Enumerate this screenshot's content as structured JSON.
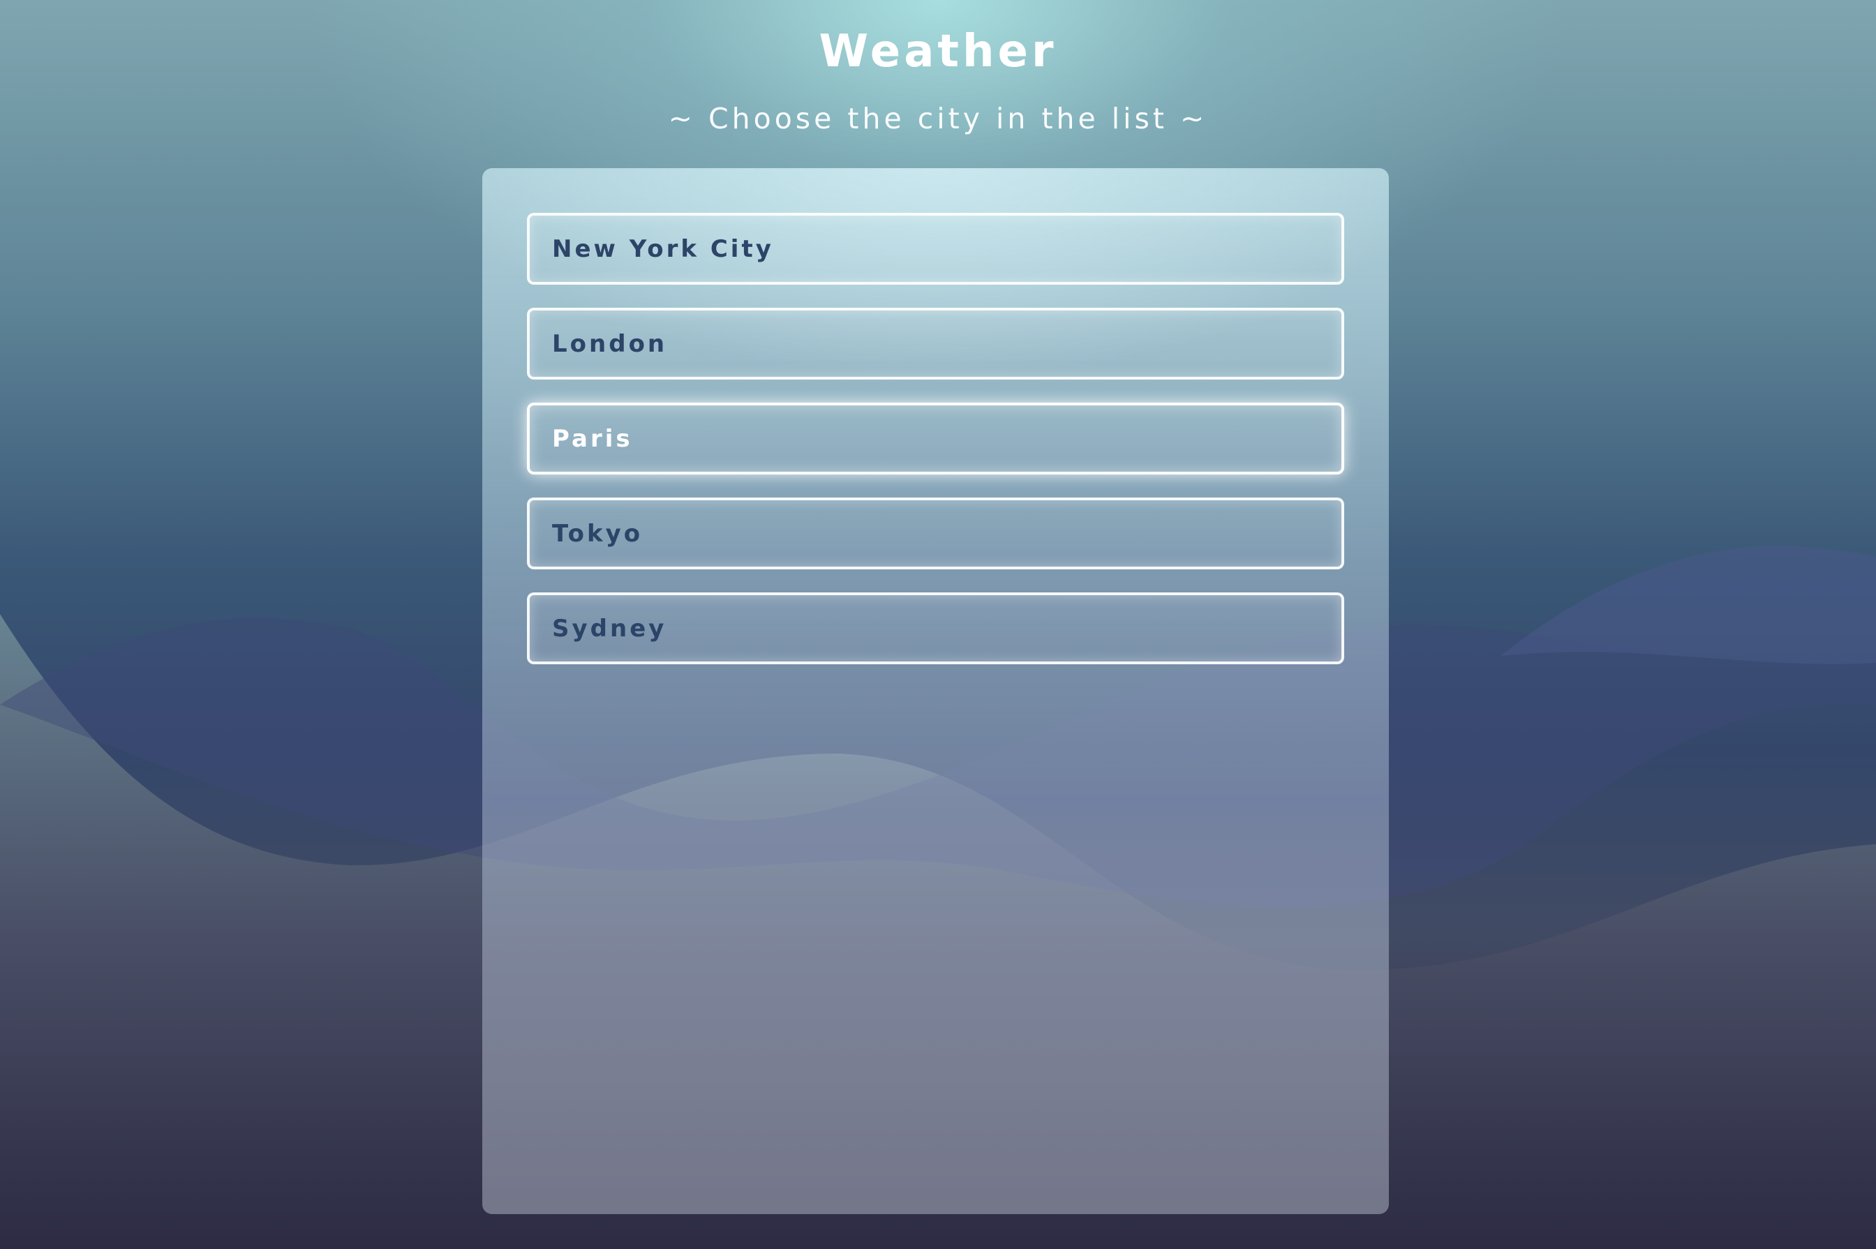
{
  "header": {
    "title": "Weather",
    "subtitle": "~ Choose the city in the list ~"
  },
  "cities": [
    {
      "name": "New York City",
      "active": false
    },
    {
      "name": "London",
      "active": false
    },
    {
      "name": "Paris",
      "active": true
    },
    {
      "name": "Tokyo",
      "active": false
    },
    {
      "name": "Sydney",
      "active": false
    }
  ],
  "colors": {
    "city_text": "#2c4468",
    "active_city_text": "#ffffff",
    "header_text": "#ffffff"
  }
}
